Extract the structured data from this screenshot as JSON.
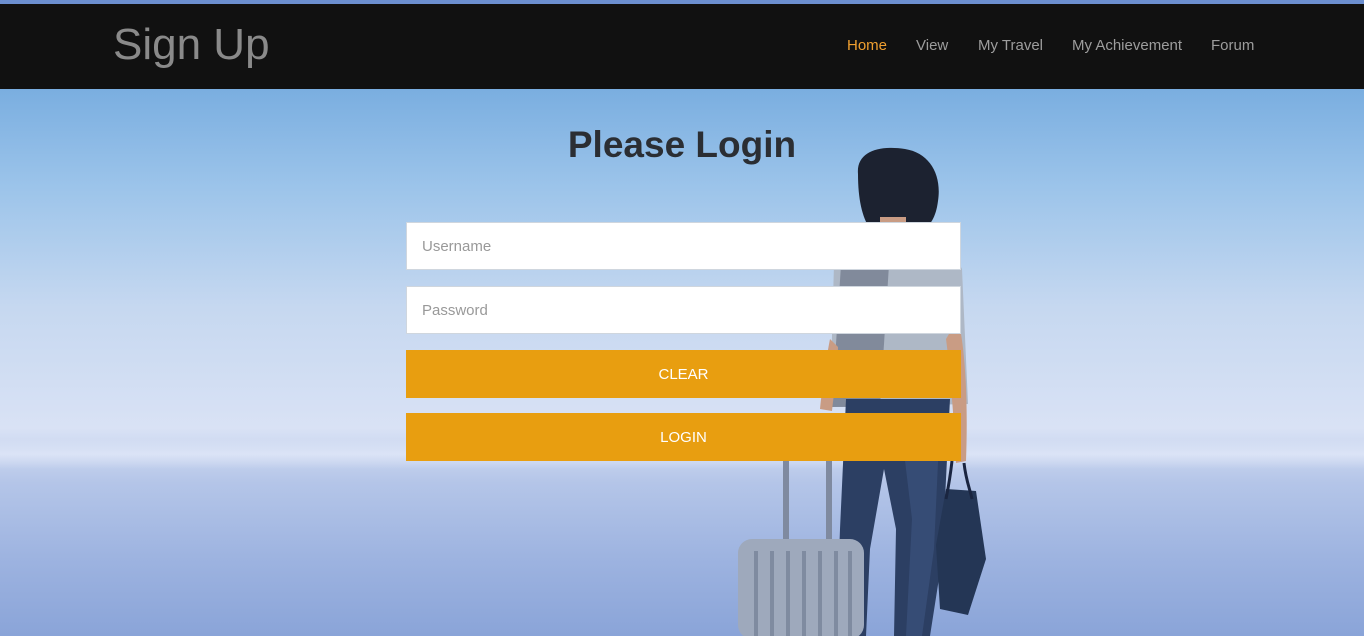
{
  "navbar": {
    "brand": "Sign Up",
    "items": [
      {
        "label": "Home",
        "active": true
      },
      {
        "label": "View",
        "active": false
      },
      {
        "label": "My Travel",
        "active": false
      },
      {
        "label": "My Achievement",
        "active": false
      },
      {
        "label": "Forum",
        "active": false
      }
    ]
  },
  "login": {
    "title": "Please Login",
    "username_placeholder": "Username",
    "password_placeholder": "Password",
    "username_value": "",
    "password_value": "",
    "clear_label": "CLEAR",
    "login_label": "LOGIN"
  },
  "colors": {
    "navbar_bg": "#111111",
    "nav_active": "#f0a030",
    "nav_text": "#9d9d9d",
    "button_bg": "#e89e10",
    "sky_top": "#7aaee0"
  },
  "background_image": "traveler-with-suitcase-sky-photo"
}
